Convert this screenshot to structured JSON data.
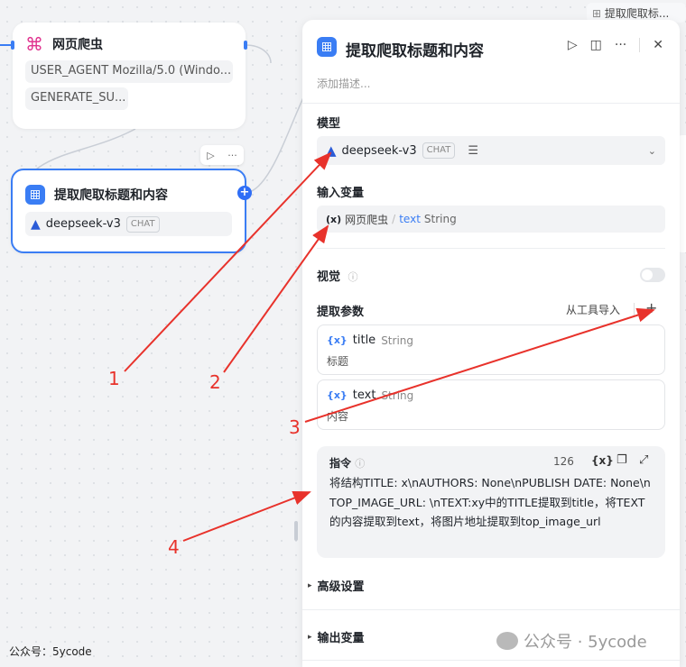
{
  "canvas": {
    "node_scraper": {
      "title": "网页爬虫",
      "params": [
        "USER_AGENT Mozilla/5.0 (Windo...",
        "GENERATE_SU..."
      ]
    },
    "node_extract": {
      "title": "提取爬取标题和内容",
      "model": "deepseek-v3",
      "model_tag": "CHAT"
    },
    "toolbar_run": "▷",
    "toolbar_more": "···",
    "plus": "+"
  },
  "panel": {
    "title": "提取爬取标题和内容",
    "description_placeholder": "添加描述...",
    "model_label": "模型",
    "model_name": "deepseek-v3",
    "model_tag": "CHAT",
    "input_var_label": "输入变量",
    "input_var_source": "网页爬虫",
    "input_var_separator": "/",
    "input_var_name": "text",
    "input_var_type": "String",
    "vision_label": "视觉",
    "extract_params_label": "提取参数",
    "import_from_tool": "从工具导入",
    "params": [
      {
        "name": "title",
        "type": "String",
        "desc": "标题"
      },
      {
        "name": "text",
        "type": "String",
        "desc": "内容"
      }
    ],
    "instruction_label": "指令",
    "instruction_count": "126",
    "instruction_text": "将结构TITLE: x\\nAUTHORS: None\\nPUBLISH DATE: None\\nTOP_IMAGE_URL: \\nTEXT:xy中的TITLE提取到title，将TEXT的内容提取到text，将图片地址提取到top_image_url",
    "advanced_label": "高级设置",
    "output_label": "输出变量"
  },
  "breadcrumb_tab": "提取爬取标...",
  "annotations": [
    "1",
    "2",
    "3",
    "4"
  ],
  "footer_left": "公众号：5ycode",
  "watermark": "公众号 · 5ycode",
  "colors": {
    "accent": "#3a7df4",
    "annotation_red": "#e8322b"
  }
}
